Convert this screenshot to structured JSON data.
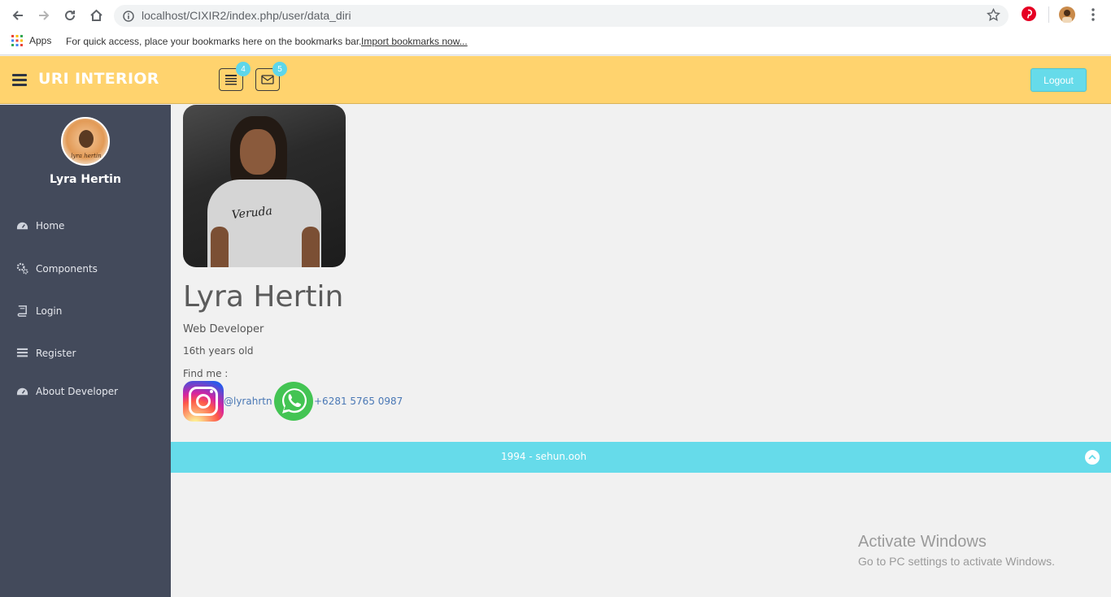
{
  "browser": {
    "url": "localhost/CIXIR2/index.php/user/data_diri",
    "bookmarks": {
      "apps_label": "Apps",
      "hint": "For quick access, place your bookmarks here on the bookmarks bar.",
      "import_link": "Import bookmarks now..."
    }
  },
  "header": {
    "brand": "URI INTERIOR",
    "tasks_badge": "4",
    "mail_badge": "5",
    "logout_label": "Logout"
  },
  "sidebar": {
    "user_name": "Lyra Hertin",
    "avatar_caption": "lyra hertin",
    "items": [
      {
        "label": "Home",
        "icon": "dashboard-icon"
      },
      {
        "label": "Components",
        "icon": "cogs-icon"
      },
      {
        "label": "Login",
        "icon": "book-icon"
      },
      {
        "label": "Register",
        "icon": "list-icon"
      },
      {
        "label": "About Developer",
        "icon": "dashboard-icon"
      }
    ]
  },
  "profile": {
    "name": "Lyra Hertin",
    "role": "Web Developer",
    "age": "16th years old",
    "find_me": "Find me :",
    "photo_shirt_text": "Veruda",
    "instagram": "@lyrahrtn",
    "whatsapp": "+6281 5765 0987"
  },
  "footer": {
    "text": "1994 - sehun.ooh"
  },
  "watermark": {
    "line1": "Activate Windows",
    "line2": "Go to PC settings to activate Windows."
  },
  "colors": {
    "header_bg": "#ffd36e",
    "sidebar_bg": "#434a5b",
    "accent": "#66dbea"
  }
}
